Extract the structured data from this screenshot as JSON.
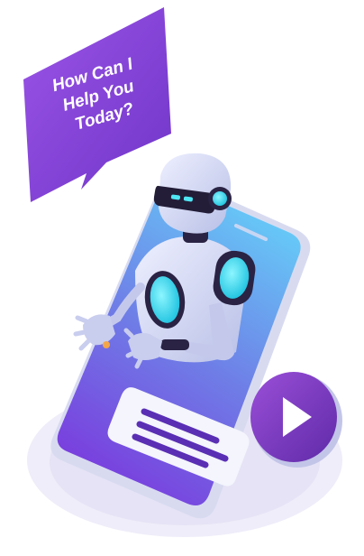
{
  "speech_bubble": {
    "lines": [
      "How Can I",
      "Help You",
      "Today?"
    ]
  },
  "colors": {
    "bubble_purple": "#8a45d4",
    "phone_gradient_top": "#59b8f5",
    "phone_gradient_bottom": "#7a3fe0",
    "play_button": "#7b3bbf",
    "robot_body": "#d9ddf5",
    "robot_accent_cyan": "#41e1f0",
    "ground_ellipse": "#eceaf8"
  },
  "icons": [
    "chat-message-icon",
    "play-icon",
    "robot-illustration"
  ]
}
